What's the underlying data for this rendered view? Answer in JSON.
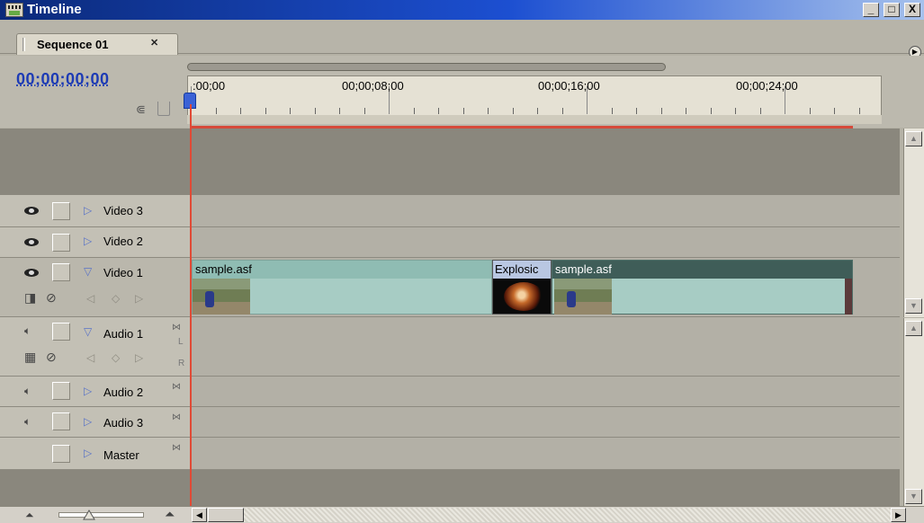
{
  "window": {
    "title": "Timeline",
    "minimize_glyph": "_",
    "maximize_glyph": "□",
    "close_glyph": "X"
  },
  "tabs": [
    {
      "label": "Sequence 01",
      "close_glyph": "✕"
    }
  ],
  "header": {
    "timecode": "00;00;00;00"
  },
  "ruler": {
    "labels": [
      ":00;00",
      "00;00;08;00",
      "00;00;16;00",
      "00;00;24;00"
    ]
  },
  "tracks": {
    "video": [
      {
        "name": "Video 3",
        "expand": "▷"
      },
      {
        "name": "Video 2",
        "expand": "▷"
      },
      {
        "name": "Video 1",
        "expand": "▽"
      }
    ],
    "audio": [
      {
        "name": "Audio 1",
        "expand": "▽",
        "channel_l": "L",
        "channel_r": "R"
      },
      {
        "name": "Audio 2",
        "expand": "▷"
      },
      {
        "name": "Audio 3",
        "expand": "▷"
      },
      {
        "name": "Master",
        "expand": "▷"
      }
    ]
  },
  "clips": [
    {
      "name": "sample.asf"
    },
    {
      "name": "Explosic"
    },
    {
      "name": "sample.asf"
    }
  ],
  "icons": {
    "eye": "eye-icon",
    "speaker": "speaker-icon",
    "sync": "⋈",
    "expand_closed": "▷",
    "expand_open": "▽"
  },
  "colors": {
    "title_bar": "#1c4fd1",
    "timecode": "#1d3bb5",
    "playhead": "#e04a36",
    "clip": "#a7ccc4",
    "clip_selected_title": "#3f5d58"
  }
}
